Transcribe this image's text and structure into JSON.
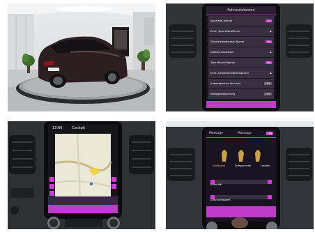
{
  "screen_tr": {
    "title": "Fahrassistenten",
    "rows": [
      {
        "label": "Spurhalte-Warner",
        "state": "ON"
      },
      {
        "label": "Einst. Spurhalte-Warner",
        "state": ""
      },
      {
        "label": "Sicherheitsabstand-Warner",
        "state": "ON"
      },
      {
        "label": "Notbremsassistent",
        "state": ""
      },
      {
        "label": "Toter-Winkel-Warner",
        "state": "ON"
      },
      {
        "label": "Einst. Geschwindigkeitswarner",
        "state": ""
      },
      {
        "label": "Automatisches Fernlicht",
        "state": "OFF"
      },
      {
        "label": "Müdigkeitswarnung",
        "state": "OFF"
      }
    ]
  },
  "screen_bl": {
    "time": "13:06",
    "header_label": "Cockpit"
  },
  "screen_br": {
    "title": "Massage",
    "left_label": "Massage",
    "toggle": "ON",
    "programs": [
      "Kraftigend",
      "Entspannend",
      "Lenden"
    ],
    "intensity_label": "Intensität",
    "speed_label": "Geschwindigkeit"
  },
  "colors": {
    "accent": "#d13ad6",
    "screen_bg": "#1a1322",
    "row_bg": "#3a2f40"
  }
}
